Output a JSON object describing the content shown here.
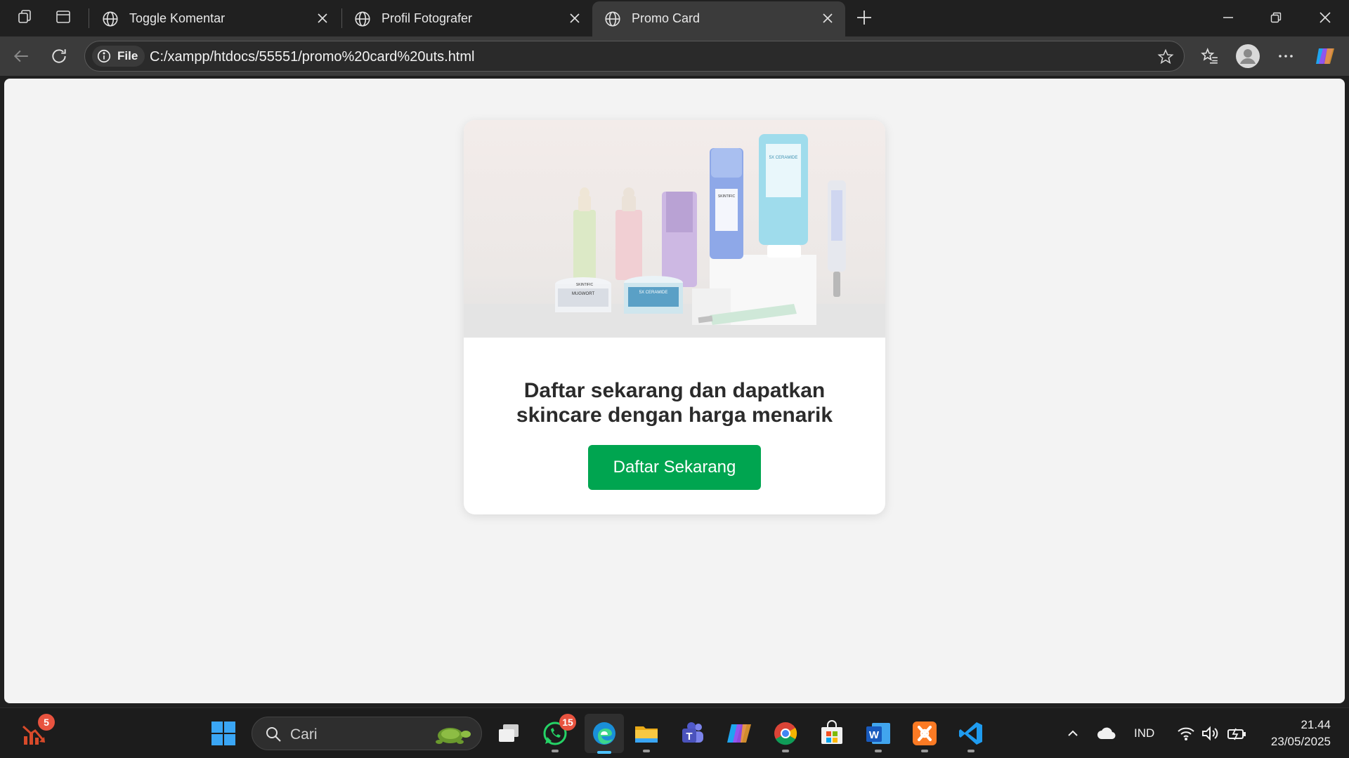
{
  "browser": {
    "tabs": [
      {
        "title": "Toggle Komentar",
        "active": false
      },
      {
        "title": "Profil Fotografer",
        "active": false
      },
      {
        "title": "Promo Card",
        "active": true
      }
    ],
    "address": {
      "scheme_label": "File",
      "url": "C:/xampp/htdocs/55551/promo%20card%20uts.html"
    }
  },
  "page": {
    "card": {
      "image_alt": "Skintific skincare product line-up",
      "heading_line1": "Daftar sekarang dan dapatkan",
      "heading_line2": "skincare dengan harga menarik",
      "button_label": "Daftar Sekarang",
      "button_color": "#00a550"
    },
    "product_labels": {
      "brand": "SKINTIFIC",
      "jar_left": "MUGWORT",
      "jar_right": "5X CERAMIDE",
      "tube": "5X CERAMIDE"
    }
  },
  "taskbar": {
    "widget_badge": "5",
    "search_placeholder": "Cari",
    "whatsapp_badge": "15",
    "language": "IND",
    "time": "21.44",
    "date": "23/05/2025"
  },
  "colors": {
    "accent": "#00a550",
    "browser_dark": "#202020",
    "page_bg": "#f3f3f3"
  }
}
